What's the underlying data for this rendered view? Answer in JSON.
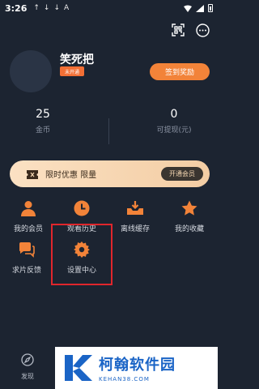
{
  "status_bar": {
    "time": "3:26",
    "notifications": [
      "↑",
      "↓",
      "↓",
      "A"
    ]
  },
  "header_icons": [
    "qr-scan-icon",
    "more-icon"
  ],
  "profile": {
    "username": "笑死把",
    "vip_status": "未开通",
    "checkin_button": "签到奖励"
  },
  "stats": [
    {
      "value": "25",
      "label": "金币"
    },
    {
      "value": "0",
      "label": "可提现(元)"
    }
  ],
  "promo": {
    "text": "限时优惠 限量",
    "button": "开通会员"
  },
  "menu": [
    {
      "label": "我的会员",
      "icon": "user-icon"
    },
    {
      "label": "观看历史",
      "icon": "clock-icon"
    },
    {
      "label": "离线缓存",
      "icon": "download-icon"
    },
    {
      "label": "我的收藏",
      "icon": "star-icon"
    },
    {
      "label": "求片反馈",
      "icon": "chat-icon"
    },
    {
      "label": "设置中心",
      "icon": "gear-icon"
    }
  ],
  "bottom_nav": {
    "discover_label": "发现"
  },
  "watermark": {
    "cn": "柯翰软件园",
    "en": "KEHAN38.COM"
  },
  "colors": {
    "background": "#1c2431",
    "accent": "#f28339",
    "highlight": "#e0262c"
  }
}
